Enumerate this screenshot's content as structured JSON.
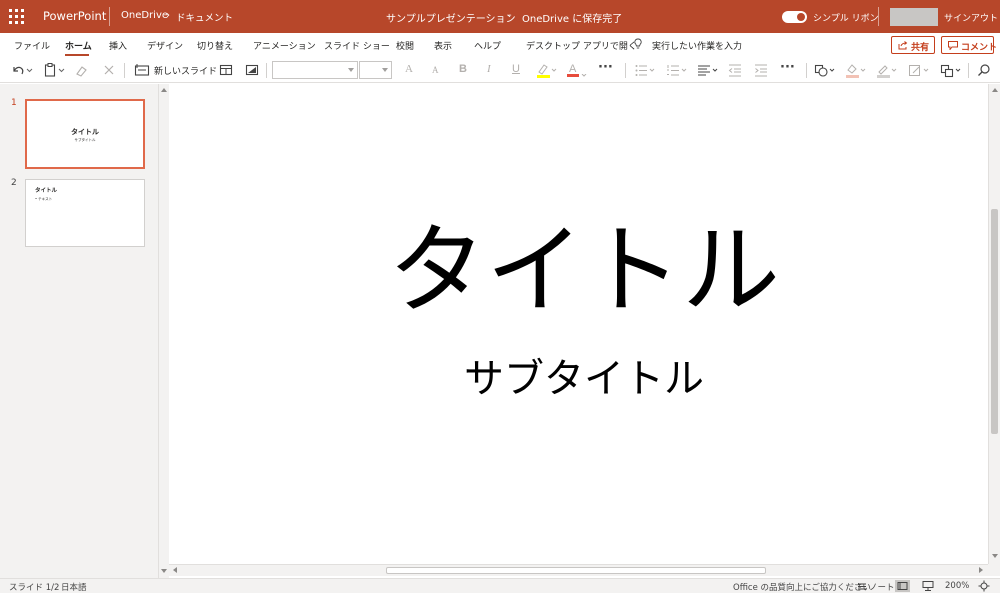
{
  "titlebar": {
    "app_name": "PowerPoint",
    "breadcrumb_root": "OneDrive",
    "breadcrumb_sep": "›",
    "breadcrumb_folder": "ドキュメント",
    "document_title": "サンプルプレゼンテーション",
    "title_dash": "-",
    "save_status": "OneDrive に保存完了",
    "simple_ribbon_label": "シンプル リボン",
    "simple_ribbon_on": true,
    "sign_out": "サインアウト"
  },
  "tabs": [
    {
      "label": "ファイル"
    },
    {
      "label": "ホーム",
      "active": true
    },
    {
      "label": "挿入"
    },
    {
      "label": "デザイン"
    },
    {
      "label": "切り替え"
    },
    {
      "label": "アニメーション"
    },
    {
      "label": "スライド ショー"
    },
    {
      "label": "校閲"
    },
    {
      "label": "表示"
    },
    {
      "label": "ヘルプ"
    },
    {
      "label": "デスクトップ アプリで開く"
    },
    {
      "label": "実行したい作業を入力"
    }
  ],
  "actions": {
    "share": "共有",
    "comment": "コメント"
  },
  "toolbar": {
    "new_slide": "新しいスライド",
    "font_name": "",
    "font_size": "",
    "grow_font": "A",
    "shrink_font": "A",
    "bold": "B",
    "italic": "I",
    "underline": "U",
    "font_color": "A",
    "more": "···"
  },
  "slides": [
    {
      "number": "1",
      "title": "タイトル",
      "subtitle": "サブタイトル",
      "selected": true
    },
    {
      "number": "2",
      "title": "タイトル",
      "bullet": "• テキスト"
    }
  ],
  "canvas": {
    "title": "タイトル",
    "subtitle": "サブタイトル"
  },
  "statusbar": {
    "slide_position": "スライド 1/2",
    "language": "日本語",
    "feedback": "Office の品質向上にご協力ください",
    "notes": "ノート",
    "zoom": "200%"
  },
  "colors": {
    "brand": "#b7472a",
    "selected_thumb_border": "#e0694a",
    "action_button": "#c43e1c"
  }
}
